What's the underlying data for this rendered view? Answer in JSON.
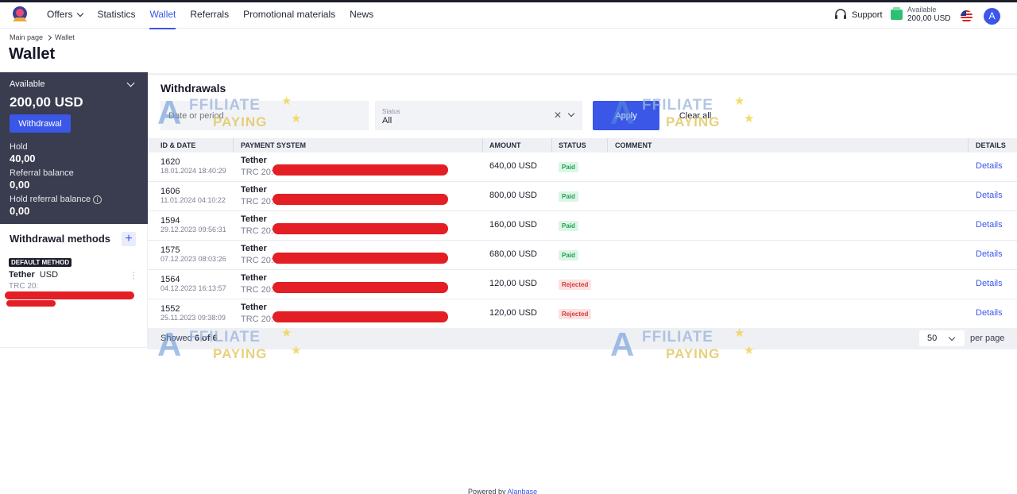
{
  "nav": {
    "items": [
      {
        "label": "Offers"
      },
      {
        "label": "Statistics"
      },
      {
        "label": "Wallet"
      },
      {
        "label": "Referrals"
      },
      {
        "label": "Promotional materials"
      },
      {
        "label": "News"
      }
    ],
    "active": "Wallet"
  },
  "topbar": {
    "support_label": "Support",
    "available_label": "Available",
    "available_value": "200,00 USD",
    "avatar_letter": "A"
  },
  "breadcrumb": {
    "home": "Main page",
    "current": "Wallet"
  },
  "page_title": "Wallet",
  "balance": {
    "available_label": "Available",
    "available_value": "200,00 USD",
    "withdrawal_button": "Withdrawal",
    "hold_label": "Hold",
    "hold_value": "40,00",
    "referral_label": "Referral balance",
    "referral_value": "0,00",
    "hold_referral_label": "Hold referral balance",
    "hold_referral_value": "0,00"
  },
  "methods": {
    "title": "Withdrawal methods",
    "add_symbol": "+",
    "default_badge": "DEFAULT METHOD",
    "method_name": "Tether",
    "method_currency": "USD",
    "method_network": "TRC 20:"
  },
  "withdrawals": {
    "title": "Withdrawals",
    "date_placeholder": "Date or period",
    "status_label": "Status",
    "status_value": "All",
    "apply_button": "Apply",
    "clear_button": "Clear all",
    "columns": {
      "id_date": "ID & DATE",
      "payment_system": "PAYMENT SYSTEM",
      "amount": "AMOUNT",
      "status": "STATUS",
      "comment": "COMMENT",
      "details": "DETAILS"
    },
    "rows": [
      {
        "id": "1620",
        "date": "18.01.2024 18:40:29",
        "system": "Tether",
        "network": "TRC 20:",
        "amount": "640,00 USD",
        "status": "Paid",
        "details": "Details"
      },
      {
        "id": "1606",
        "date": "11.01.2024 04:10:22",
        "system": "Tether",
        "network": "TRC 20:",
        "amount": "800,00 USD",
        "status": "Paid",
        "details": "Details"
      },
      {
        "id": "1594",
        "date": "29.12.2023 09:56:31",
        "system": "Tether",
        "network": "TRC 20:",
        "amount": "160,00 USD",
        "status": "Paid",
        "details": "Details"
      },
      {
        "id": "1575",
        "date": "07.12.2023 08:03:26",
        "system": "Tether",
        "network": "TRC 20:",
        "amount": "680,00 USD",
        "status": "Paid",
        "details": "Details"
      },
      {
        "id": "1564",
        "date": "04.12.2023 16:13:57",
        "system": "Tether",
        "network": "TRC 20:",
        "amount": "120,00 USD",
        "status": "Rejected",
        "details": "Details"
      },
      {
        "id": "1552",
        "date": "25.11.2023 09:38:09",
        "system": "Tether",
        "network": "TRC 20:",
        "amount": "120,00 USD",
        "status": "Rejected",
        "details": "Details"
      }
    ],
    "showed_prefix": "Showed",
    "showed_count": "6 of 6",
    "per_page_value": "50",
    "per_page_label": "per page"
  },
  "footer": {
    "powered_by": "Powered by",
    "brand": "Alanbase"
  },
  "watermark": {
    "line1": "FFILIATE",
    "line2": "PAYING",
    "letter": "A"
  },
  "colors": {
    "accent": "#3a57e8",
    "panel": "#3a3c4f",
    "paid": "#1f9d55",
    "rejected": "#d63b3b",
    "redaction": "#e31e24"
  }
}
